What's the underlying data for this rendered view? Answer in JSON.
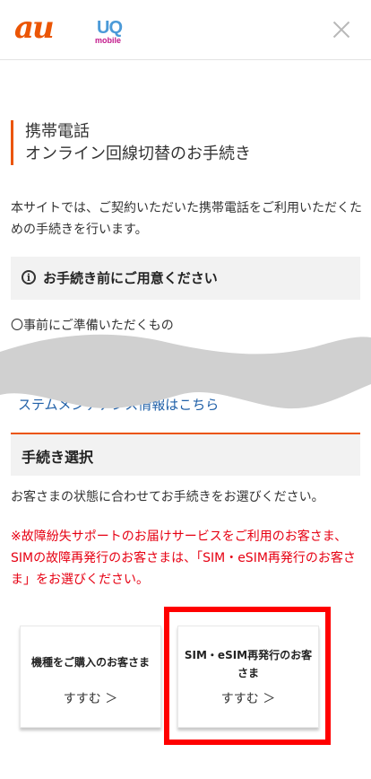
{
  "header": {
    "logo_au": "au",
    "logo_uq": "UQ",
    "logo_uq_sub": "mobile",
    "close_icon": "close-icon"
  },
  "page": {
    "title_line1": "携帯電話",
    "title_line2": "オンライン回線切替のお手続き",
    "intro": "本サイトでは、ご契約いただいた携帯電話をご利用いただくための手続きを行います。"
  },
  "notice": {
    "icon": "info-icon",
    "title": "お手続き前にご用意ください"
  },
  "prep_text": "〇事前にご準備いただくもの",
  "system_link": "ステムメンテナンス情報はこちら",
  "selection": {
    "title": "手続き選択",
    "description": "お客さまの状態に合わせてお手続きをお選びください。",
    "note": "※故障紛失サポートのお届けサービスをご利用のお客さま、SIMの故障再発行のお客さまは、「SIM・eSIM再発行のお客さま」をお選びください。",
    "cards": [
      {
        "title": "機種をご購入のお客さま",
        "action": "すすむ ＞"
      },
      {
        "title": "SIM・eSIM再発行のお客さま",
        "action": "すすむ ＞"
      }
    ]
  },
  "colors": {
    "brand_orange": "#eb5505",
    "note_red": "#e60012",
    "link_blue": "#2060a8",
    "highlight_red": "#ff0000"
  }
}
